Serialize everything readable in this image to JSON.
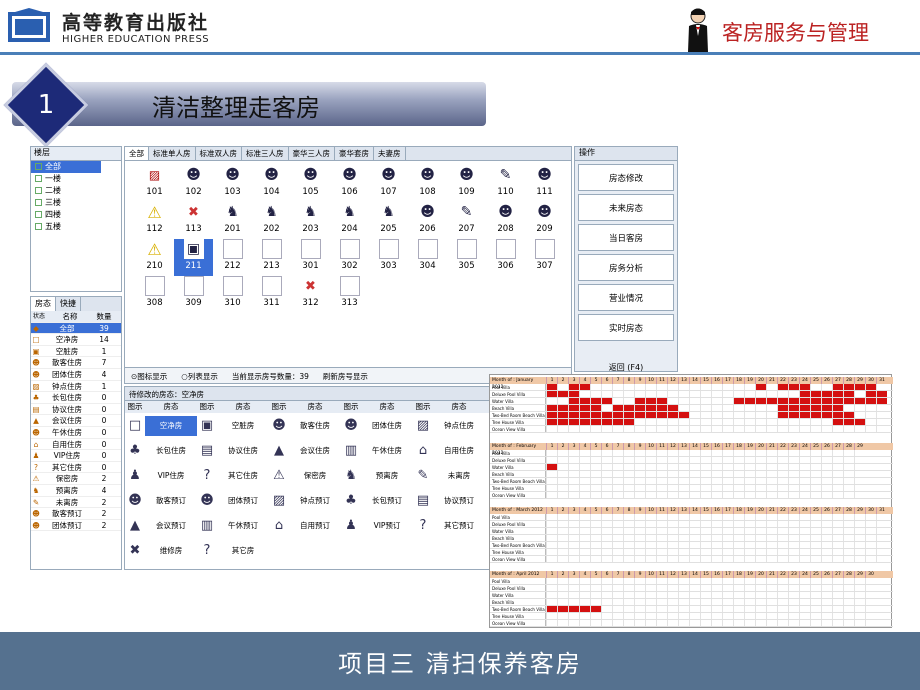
{
  "publisher": {
    "name_cn": "高等教育出版社",
    "name_en": "HIGHER EDUCATION PRESS"
  },
  "course_title": "客房服务与管理",
  "section": {
    "number": "1",
    "title": "清洁整理走客房"
  },
  "tree": {
    "header": "楼层",
    "items": [
      {
        "label": "全部",
        "selected": true
      },
      {
        "label": "一楼"
      },
      {
        "label": "二楼"
      },
      {
        "label": "三楼"
      },
      {
        "label": "四楼"
      },
      {
        "label": "五楼"
      }
    ]
  },
  "stat": {
    "tabs": [
      "房态",
      "快捷"
    ],
    "head": {
      "c1": "状态",
      "c2": "名称",
      "c3": "数量"
    },
    "rows": [
      {
        "icon": "◆",
        "name": "全部",
        "count": "39",
        "selected": true
      },
      {
        "icon": "□",
        "name": "空净房",
        "count": "14"
      },
      {
        "icon": "▣",
        "name": "空脏房",
        "count": "1"
      },
      {
        "icon": "☻",
        "name": "散客住房",
        "count": "7"
      },
      {
        "icon": "☻",
        "name": "团体住房",
        "count": "4"
      },
      {
        "icon": "▨",
        "name": "钟点住房",
        "count": "1"
      },
      {
        "icon": "♣",
        "name": "长包住房",
        "count": "0"
      },
      {
        "icon": "▤",
        "name": "协议住房",
        "count": "0"
      },
      {
        "icon": "▲",
        "name": "会议住房",
        "count": "0"
      },
      {
        "icon": "☻",
        "name": "午休住房",
        "count": "0"
      },
      {
        "icon": "⌂",
        "name": "自用住房",
        "count": "0"
      },
      {
        "icon": "♟",
        "name": "VIP住房",
        "count": "0"
      },
      {
        "icon": "?",
        "name": "其它住房",
        "count": "0"
      },
      {
        "icon": "⚠",
        "name": "保密房",
        "count": "2"
      },
      {
        "icon": "♞",
        "name": "预离房",
        "count": "4"
      },
      {
        "icon": "✎",
        "name": "未离房",
        "count": "2"
      },
      {
        "icon": "☻",
        "name": "散客预订",
        "count": "2"
      },
      {
        "icon": "☻",
        "name": "团体预订",
        "count": "2"
      }
    ]
  },
  "room_tabs": [
    "全部",
    "标准单人房",
    "标准双人房",
    "标准三人房",
    "豪华三人房",
    "豪华套房",
    "夫妻房"
  ],
  "rooms": [
    {
      "no": "101",
      "state": "ooo",
      "icon": "▨"
    },
    {
      "no": "102",
      "state": "dirty",
      "icon": "☻"
    },
    {
      "no": "103",
      "state": "dirty",
      "icon": "☻"
    },
    {
      "no": "104",
      "state": "dirty",
      "icon": "☻"
    },
    {
      "no": "105",
      "state": "dirty",
      "icon": "☻"
    },
    {
      "no": "106",
      "state": "dirty",
      "icon": "☻"
    },
    {
      "no": "107",
      "state": "dirty",
      "icon": "☻"
    },
    {
      "no": "108",
      "state": "dirty",
      "icon": "☻"
    },
    {
      "no": "109",
      "state": "dirty",
      "icon": "☻"
    },
    {
      "no": "110",
      "state": "dirty",
      "icon": "✎"
    },
    {
      "no": "111",
      "state": "dirty",
      "icon": "☻"
    },
    {
      "no": "112",
      "state": "warn",
      "icon": "⚠"
    },
    {
      "no": "113",
      "state": "repair",
      "icon": "✖"
    },
    {
      "no": "201",
      "state": "dirty",
      "icon": "♞"
    },
    {
      "no": "202",
      "state": "dirty",
      "icon": "♞"
    },
    {
      "no": "203",
      "state": "dirty",
      "icon": "♞"
    },
    {
      "no": "204",
      "state": "dirty",
      "icon": "♞"
    },
    {
      "no": "205",
      "state": "dirty",
      "icon": "♞"
    },
    {
      "no": "206",
      "state": "dirty",
      "icon": "☻"
    },
    {
      "no": "207",
      "state": "dirty",
      "icon": "✎"
    },
    {
      "no": "208",
      "state": "dirty",
      "icon": "☻"
    },
    {
      "no": "209",
      "state": "dirty",
      "icon": "☻"
    },
    {
      "no": "210",
      "state": "warn",
      "icon": "⚠"
    },
    {
      "no": "211",
      "state": "dirty",
      "icon": "▣",
      "selected": true
    },
    {
      "no": "212",
      "state": "empty",
      "icon": ""
    },
    {
      "no": "213",
      "state": "empty",
      "icon": ""
    },
    {
      "no": "301",
      "state": "empty",
      "icon": ""
    },
    {
      "no": "302",
      "state": "empty",
      "icon": ""
    },
    {
      "no": "303",
      "state": "empty",
      "icon": ""
    },
    {
      "no": "304",
      "state": "empty",
      "icon": ""
    },
    {
      "no": "305",
      "state": "empty",
      "icon": ""
    },
    {
      "no": "306",
      "state": "empty",
      "icon": ""
    },
    {
      "no": "307",
      "state": "empty",
      "icon": ""
    },
    {
      "no": "308",
      "state": "empty",
      "icon": ""
    },
    {
      "no": "309",
      "state": "empty",
      "icon": ""
    },
    {
      "no": "310",
      "state": "empty",
      "icon": ""
    },
    {
      "no": "311",
      "state": "empty",
      "icon": ""
    },
    {
      "no": "312",
      "state": "repair",
      "icon": "✖"
    },
    {
      "no": "313",
      "state": "empty",
      "icon": ""
    }
  ],
  "room_footer": {
    "opt1": "⊙图标显示",
    "opt2": "○列表显示",
    "count": "当前显示房号数量：39",
    "refresh": "刷新房号显示"
  },
  "ops": {
    "tab": "操作",
    "buttons": [
      "房态修改",
      "未来房态",
      "当日客房",
      "房务分析",
      "营业情况",
      "实时房态"
    ],
    "back": "返回 (F4)"
  },
  "legend": {
    "title": "待修改的房态：空净房",
    "head": [
      "图示",
      "房态",
      "图示",
      "房态",
      "图示",
      "房态",
      "图示",
      "房态",
      "图示",
      "房态"
    ],
    "cells": [
      {
        "icon": "□",
        "label": "空净房",
        "selected": true
      },
      {
        "icon": "▣",
        "label": "空脏房"
      },
      {
        "icon": "☻",
        "label": "散客住房"
      },
      {
        "icon": "☻",
        "label": "团体住房"
      },
      {
        "icon": "▨",
        "label": "钟点住房"
      },
      {
        "icon": "♣",
        "label": "长包住房"
      },
      {
        "icon": "▤",
        "label": "协议住房"
      },
      {
        "icon": "▲",
        "label": "会议住房"
      },
      {
        "icon": "▥",
        "label": "午休住房"
      },
      {
        "icon": "⌂",
        "label": "自用住房"
      },
      {
        "icon": "♟",
        "label": "VIP住房"
      },
      {
        "icon": "?",
        "label": "其它住房"
      },
      {
        "icon": "⚠",
        "label": "保密房"
      },
      {
        "icon": "♞",
        "label": "预离房"
      },
      {
        "icon": "✎",
        "label": "未离房"
      },
      {
        "icon": "☻",
        "label": "散客预订"
      },
      {
        "icon": "☻",
        "label": "团体预订"
      },
      {
        "icon": "▨",
        "label": "钟点预订"
      },
      {
        "icon": "♣",
        "label": "长包预订"
      },
      {
        "icon": "▤",
        "label": "协议预订"
      },
      {
        "icon": "▲",
        "label": "会议预订"
      },
      {
        "icon": "▥",
        "label": "午休预订"
      },
      {
        "icon": "⌂",
        "label": "自用预订"
      },
      {
        "icon": "♟",
        "label": "VIP预订"
      },
      {
        "icon": "?",
        "label": "其它预订"
      },
      {
        "icon": "✖",
        "label": "维修房"
      },
      {
        "icon": "?",
        "label": "其它房"
      }
    ]
  },
  "calendar": {
    "rooms": [
      "Pool Villa",
      "Deluxe Pool Villa",
      "Water Villa",
      "Beach Villa",
      "Two-Bed Room Beach Villa",
      "Tree House Villa",
      "Ocean View Villa"
    ],
    "months": [
      {
        "label": "Month of : January 2012",
        "days": 31,
        "red": [
          [
            1,
            3,
            4,
            20,
            22,
            23,
            24,
            27,
            28,
            29,
            30
          ],
          [
            1,
            2,
            3,
            24,
            25,
            26,
            27,
            28,
            30,
            31
          ],
          [
            3,
            4,
            5,
            6,
            9,
            10,
            11,
            18,
            19,
            20,
            21,
            22,
            23,
            24,
            25,
            26,
            27,
            28,
            29,
            30,
            31
          ],
          [
            1,
            2,
            3,
            4,
            5,
            7,
            8,
            9,
            10,
            11,
            12,
            22,
            23,
            24,
            25,
            26,
            27
          ],
          [
            1,
            2,
            3,
            4,
            5,
            6,
            7,
            8,
            9,
            10,
            11,
            12,
            13,
            22,
            23,
            24,
            25,
            26,
            27,
            28
          ],
          [
            1,
            2,
            3,
            4,
            5,
            6,
            7,
            8,
            27,
            28,
            29
          ],
          []
        ]
      },
      {
        "label": "Month of : February 2012",
        "days": 29,
        "red": [
          [],
          [],
          [
            1
          ],
          [],
          [],
          [],
          []
        ]
      },
      {
        "label": "Month of : March 2012",
        "days": 31,
        "red": [
          [],
          [],
          [],
          [],
          [],
          [],
          []
        ]
      },
      {
        "label": "Month of : April 2012",
        "days": 30,
        "red": [
          [],
          [],
          [],
          [],
          [
            1,
            2,
            3,
            4,
            5
          ],
          [],
          []
        ]
      }
    ]
  },
  "footer": "项目三  清扫保养客房"
}
